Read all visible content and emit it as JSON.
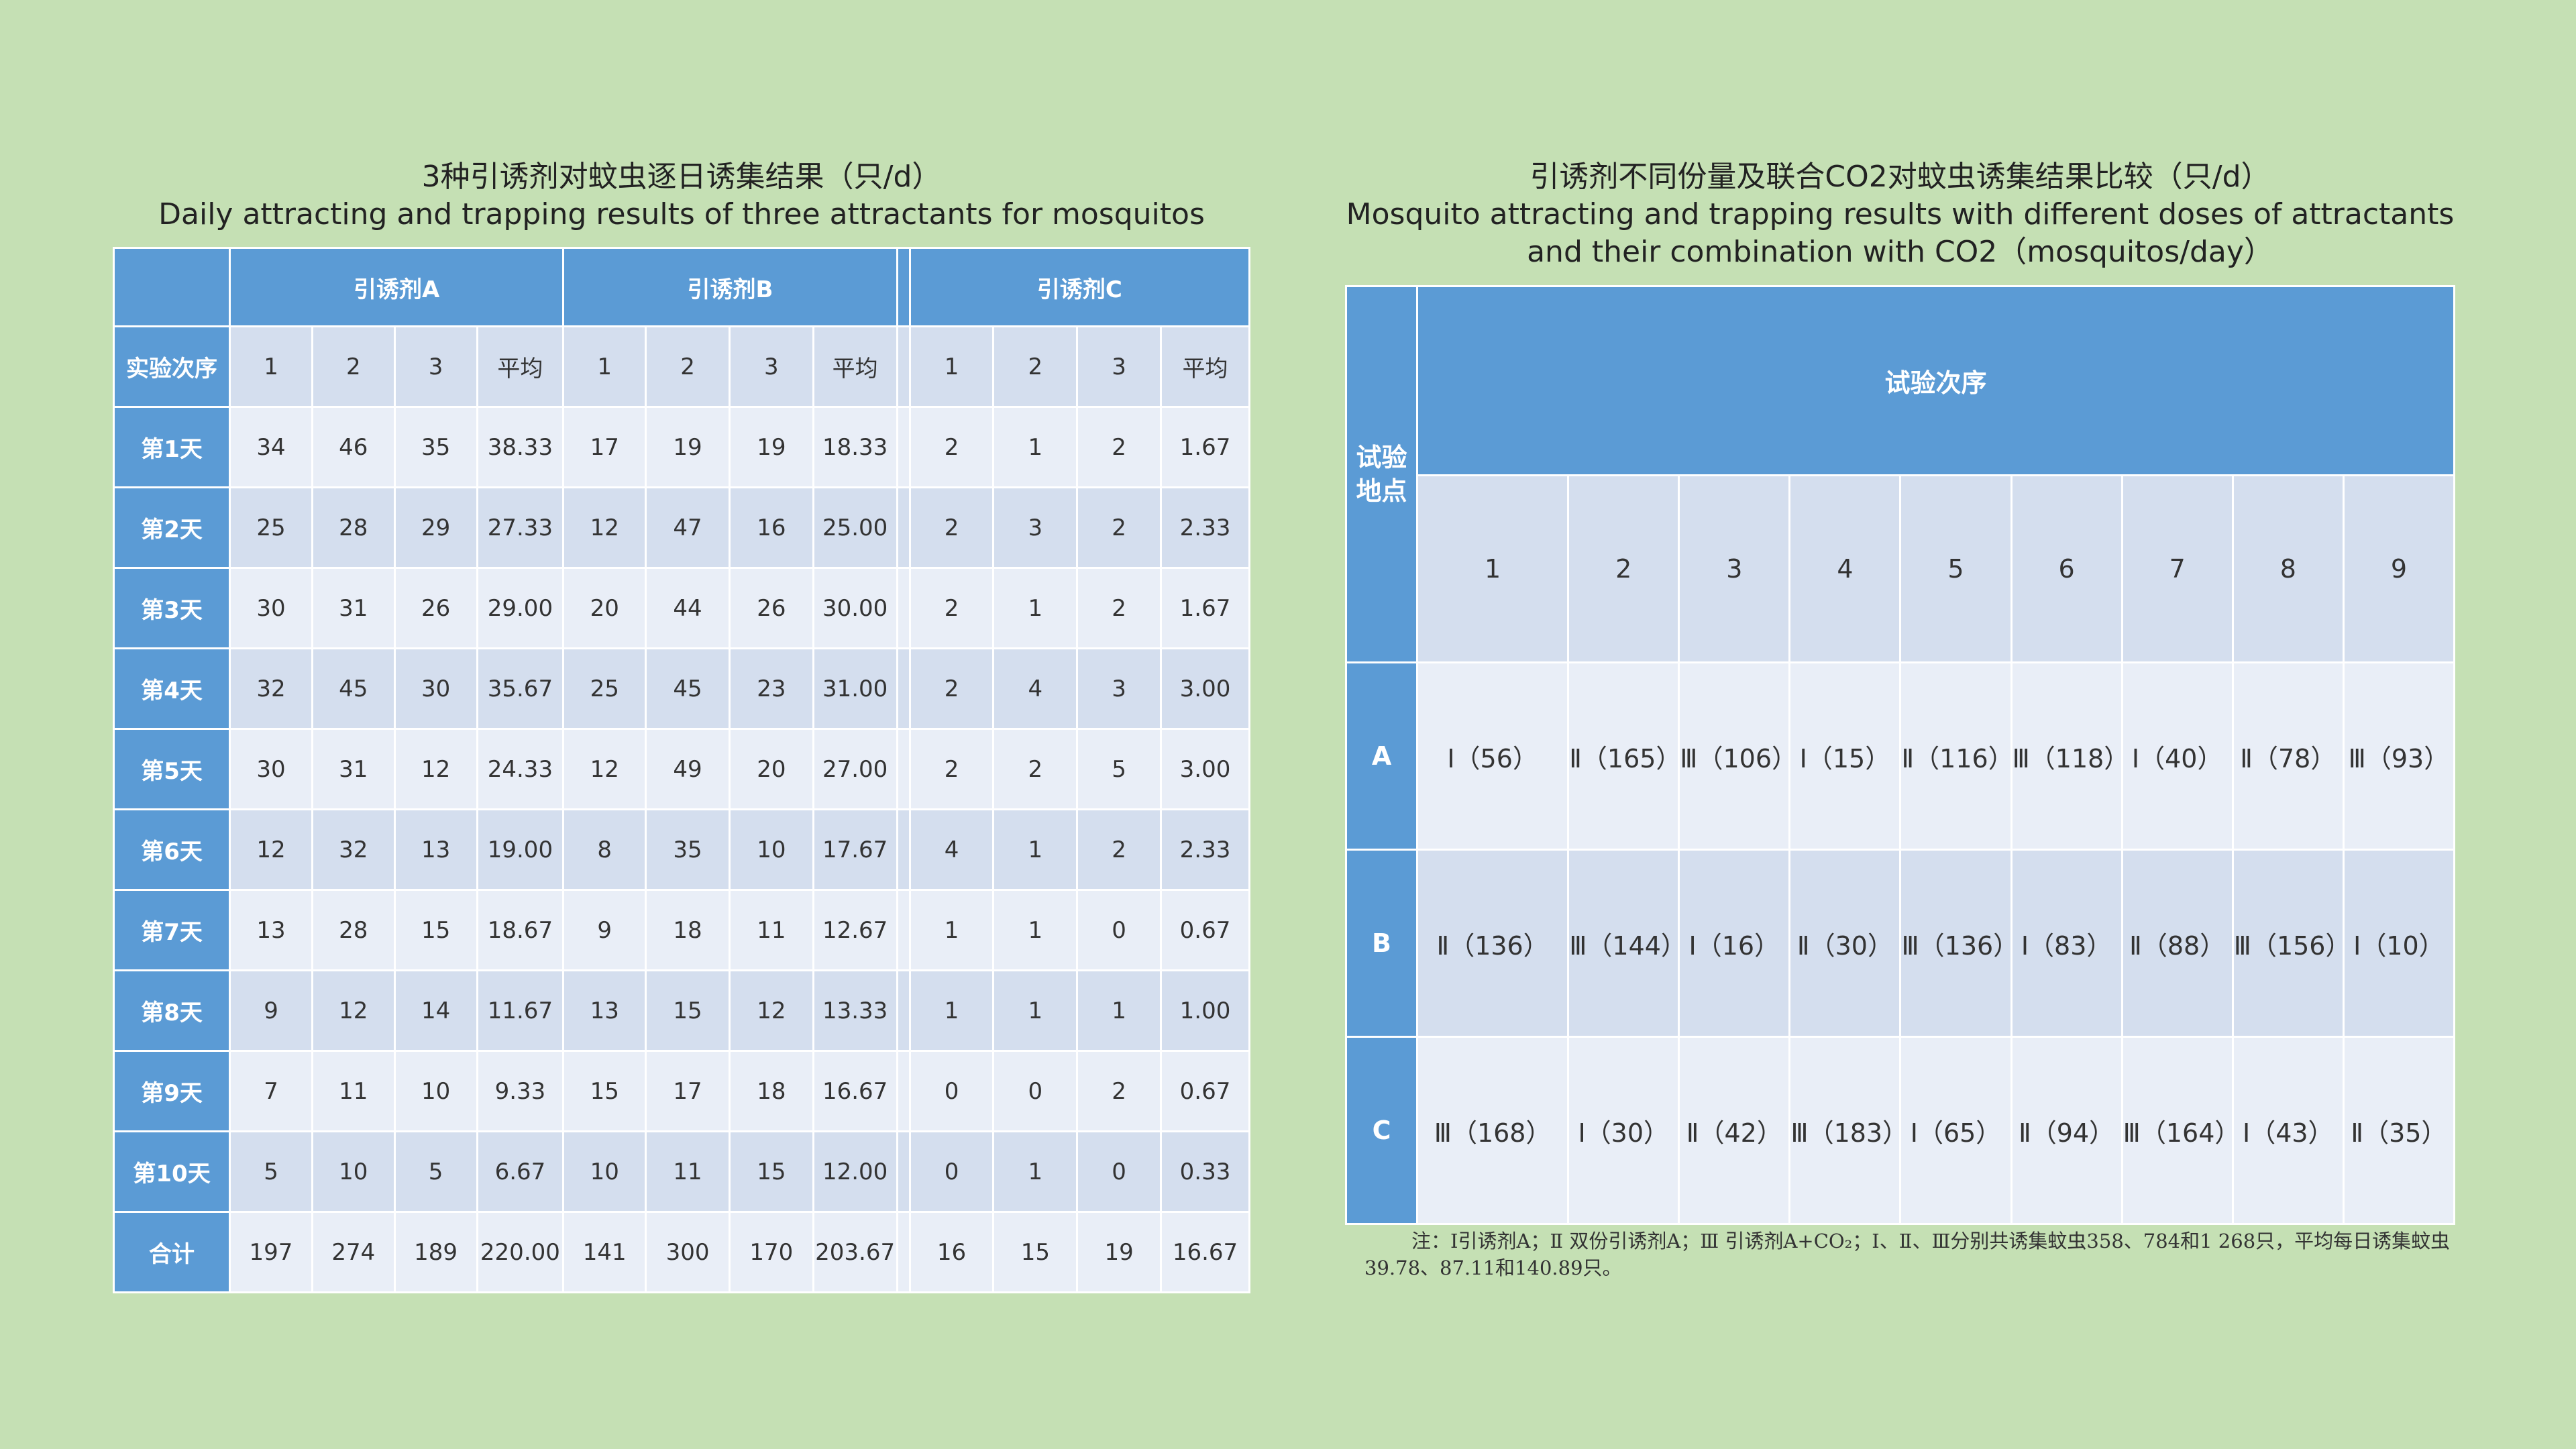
{
  "left_panel": {
    "title_cn": "3种引诱剂对蚊虫逐日诱集结果（只/d）",
    "title_en": "Daily attracting and trapping results of three attractants for mosquitos",
    "groups": [
      "引诱剂A",
      "引诱剂B",
      "引诱剂C"
    ],
    "row_header": "实验次序",
    "sub_headers": [
      "1",
      "2",
      "3",
      "平均"
    ],
    "rows": [
      {
        "label": "第1天",
        "a": [
          "34",
          "46",
          "35",
          "38.33"
        ],
        "b": [
          "17",
          "19",
          "19",
          "18.33"
        ],
        "c": [
          "2",
          "1",
          "2",
          "1.67"
        ]
      },
      {
        "label": "第2天",
        "a": [
          "25",
          "28",
          "29",
          "27.33"
        ],
        "b": [
          "12",
          "47",
          "16",
          "25.00"
        ],
        "c": [
          "2",
          "3",
          "2",
          "2.33"
        ]
      },
      {
        "label": "第3天",
        "a": [
          "30",
          "31",
          "26",
          "29.00"
        ],
        "b": [
          "20",
          "44",
          "26",
          "30.00"
        ],
        "c": [
          "2",
          "1",
          "2",
          "1.67"
        ]
      },
      {
        "label": "第4天",
        "a": [
          "32",
          "45",
          "30",
          "35.67"
        ],
        "b": [
          "25",
          "45",
          "23",
          "31.00"
        ],
        "c": [
          "2",
          "4",
          "3",
          "3.00"
        ]
      },
      {
        "label": "第5天",
        "a": [
          "30",
          "31",
          "12",
          "24.33"
        ],
        "b": [
          "12",
          "49",
          "20",
          "27.00"
        ],
        "c": [
          "2",
          "2",
          "5",
          "3.00"
        ]
      },
      {
        "label": "第6天",
        "a": [
          "12",
          "32",
          "13",
          "19.00"
        ],
        "b": [
          "8",
          "35",
          "10",
          "17.67"
        ],
        "c": [
          "4",
          "1",
          "2",
          "2.33"
        ]
      },
      {
        "label": "第7天",
        "a": [
          "13",
          "28",
          "15",
          "18.67"
        ],
        "b": [
          "9",
          "18",
          "11",
          "12.67"
        ],
        "c": [
          "1",
          "1",
          "0",
          "0.67"
        ]
      },
      {
        "label": "第8天",
        "a": [
          "9",
          "12",
          "14",
          "11.67"
        ],
        "b": [
          "13",
          "15",
          "12",
          "13.33"
        ],
        "c": [
          "1",
          "1",
          "1",
          "1.00"
        ]
      },
      {
        "label": "第9天",
        "a": [
          "7",
          "11",
          "10",
          "9.33"
        ],
        "b": [
          "15",
          "17",
          "18",
          "16.67"
        ],
        "c": [
          "0",
          "0",
          "2",
          "0.67"
        ]
      },
      {
        "label": "第10天",
        "a": [
          "5",
          "10",
          "5",
          "6.67"
        ],
        "b": [
          "10",
          "11",
          "15",
          "12.00"
        ],
        "c": [
          "0",
          "1",
          "0",
          "0.33"
        ]
      },
      {
        "label": "合计",
        "a": [
          "197",
          "274",
          "189",
          "220.00"
        ],
        "b": [
          "141",
          "300",
          "170",
          "203.67"
        ],
        "c": [
          "16",
          "15",
          "19",
          "16.67"
        ]
      }
    ]
  },
  "right_panel": {
    "title_cn": "引诱剂不同份量及联合CO2对蚊虫诱集结果比较（只/d）",
    "title_en_1": "Mosquito attracting and trapping results with different doses of attractants",
    "title_en_2": "and their combination with CO2（mosquitos/day）",
    "corner_header": "试验地点",
    "top_header": "试验次序",
    "columns": [
      "1",
      "2",
      "3",
      "4",
      "5",
      "6",
      "7",
      "8",
      "9"
    ],
    "rows": [
      {
        "label": "A",
        "cells": [
          "Ⅰ（56）",
          "Ⅱ（165）",
          "Ⅲ（106）",
          "Ⅰ（15）",
          "Ⅱ（116）",
          "Ⅲ（118）",
          "Ⅰ（40）",
          "Ⅱ（78）",
          "Ⅲ（93）"
        ]
      },
      {
        "label": "B",
        "cells": [
          "Ⅱ（136）",
          "Ⅲ（144）",
          "Ⅰ（16）",
          "Ⅱ（30）",
          "Ⅲ（136）",
          "Ⅰ（83）",
          "Ⅱ（88）",
          "Ⅲ（156）",
          "Ⅰ（10）"
        ]
      },
      {
        "label": "C",
        "cells": [
          "Ⅲ（168）",
          "Ⅰ（30）",
          "Ⅱ（42）",
          "Ⅲ（183）",
          "Ⅰ（65）",
          "Ⅱ（94）",
          "Ⅲ（164）",
          "Ⅰ（43）",
          "Ⅱ（35）"
        ]
      }
    ],
    "note": "注：Ⅰ引诱剂A；Ⅱ 双份引诱剂A；Ⅲ 引诱剂A+CO₂；Ⅰ、Ⅱ、Ⅲ分别共诱集蚊虫358、784和1 268只，平均每日诱集蚊虫39.78、87.11和140.89只。"
  },
  "colors": {
    "background": "#c5e0b4",
    "header_blue": "#5b9bd5",
    "cell_dark": "#d4deee",
    "cell_light": "#e9eef7"
  }
}
